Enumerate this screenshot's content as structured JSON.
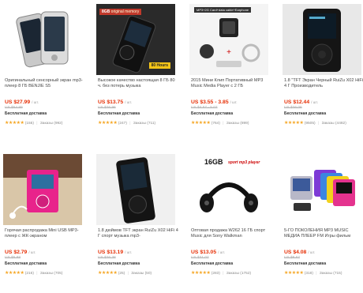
{
  "products": [
    {
      "title": "Оригинальный сенсорный экран mp3-плеер 8 ГБ BENJIE S5",
      "price": "US $27.99",
      "unit": "/ шт.",
      "old_price": "US $54.89",
      "shipping": "Бесплатная доставка",
      "rating_count": "(155)",
      "orders": "Заказы (992)",
      "image_icon": "silver-mp3-player-image"
    },
    {
      "title": "Высокое качество настоящая 8 ГБ 80 ч. без потерь музыка",
      "price": "US $13.75",
      "unit": "/ шт.",
      "old_price": "US $26.96",
      "shipping": "Бесплатная доставка",
      "rating_count": "(247)",
      "orders": "Заказы (711)",
      "image_icon": "black-mp3-player-image",
      "badge_top": "8GB",
      "badge_top_extra": "original memory",
      "badge_bottom": "80 Hours"
    },
    {
      "title": "2015 Мини Клип Портативный MP3 Music Media Player с 2 ГБ",
      "price": "US $3.55 - 3.85",
      "unit": "/ шт.",
      "old_price": "US $4.57 - 5.07",
      "shipping": "Бесплатная доставка",
      "rating_count": "(764)",
      "orders": "Заказы (899)",
      "image_icon": "clip-mp3-player-image",
      "badge_top": "MP3+2G Card+data cable+Earphone"
    },
    {
      "title": "1.8 \"TFT Экран Черный RuiZu X02 HiFi 4 Г Производитель",
      "price": "US $12.44",
      "unit": "/ шт.",
      "old_price": "US $26.06",
      "shipping": "Бесплатная доставка",
      "rating_count": "(9505)",
      "orders": "Заказы (4482)",
      "image_icon": "black-hifi-player-image"
    },
    {
      "title": "Горячая распродажа Mini USB MP3-плеер с ЖК-экраном",
      "price": "US $2.79",
      "unit": "/ шт.",
      "old_price": "US $5.88",
      "shipping": "Бесплатная доставка",
      "rating_count": "(216)",
      "orders": "Заказы (705)",
      "image_icon": "pink-mini-player-image"
    },
    {
      "title": "1.8 дюймов TFT экран RuiZu X02 HiFi 4 Г спорт музыка mp3-",
      "price": "US $13.19",
      "unit": "/ шт.",
      "old_price": "US $26.38",
      "shipping": "Бесплатная доставка",
      "rating_count": "(25)",
      "orders": "Заказы (50)",
      "image_icon": "black-sport-player-image"
    },
    {
      "title": "Оптовая продажа W262 16 ГБ спорт Music для Sony Walkman",
      "price": "US $13.05",
      "unit": "/ шт.",
      "old_price": "US $31.07",
      "shipping": "Бесплатная доставка",
      "rating_count": "(283)",
      "orders": "Заказы (1752)",
      "image_icon": "sport-headphone-player-image",
      "badge_top": "16GB",
      "badge_top_extra": "sport mp3 player"
    },
    {
      "title": "5-ГО ПОКОЛЕНИЯ MP3 MUSIC МЕДИА ПЛЕЕР FM Игры фильм",
      "price": "US $4.08",
      "unit": "/ шт.",
      "old_price": "US $8.67",
      "shipping": "Бесплатная доставка",
      "rating_count": "(318)",
      "orders": "Заказы (715)",
      "image_icon": "colorful-nano-players-image"
    }
  ],
  "stars": "★★★★★",
  "separator": "|",
  "colors": {
    "price": "#e62e04",
    "stars": "#f5a623"
  }
}
